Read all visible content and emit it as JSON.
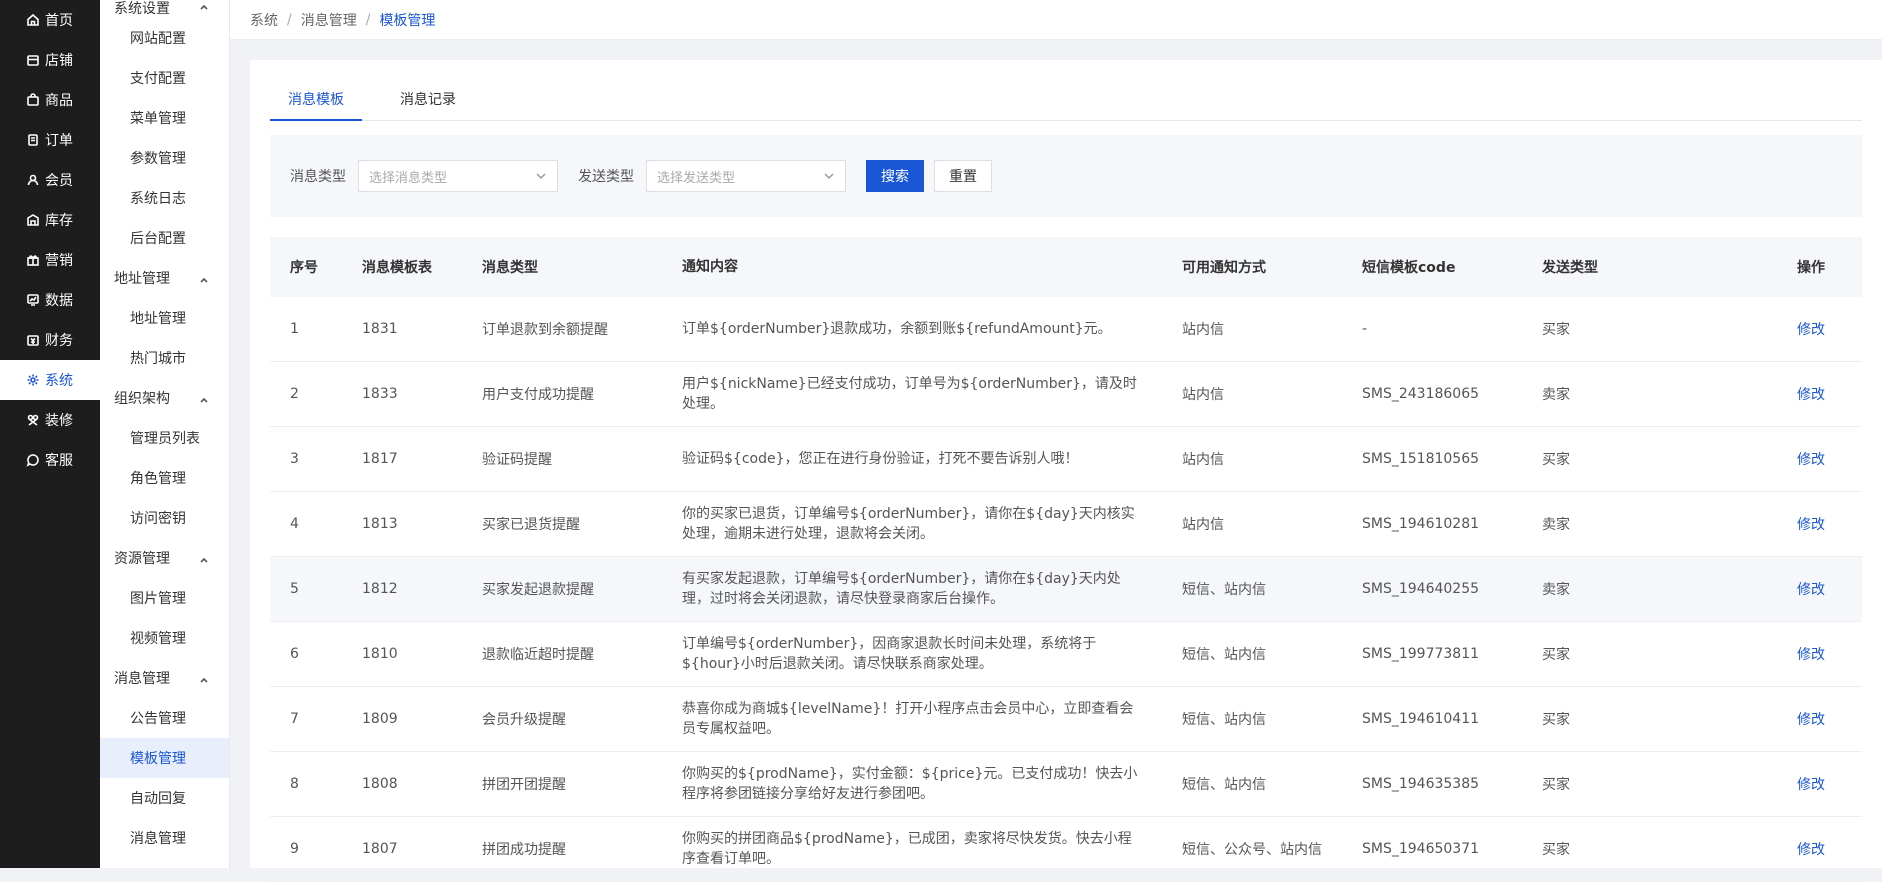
{
  "nav": [
    {
      "label": "首页",
      "icon": "home-icon"
    },
    {
      "label": "店铺",
      "icon": "shop-icon"
    },
    {
      "label": "商品",
      "icon": "product-icon"
    },
    {
      "label": "订单",
      "icon": "order-icon"
    },
    {
      "label": "会员",
      "icon": "member-icon"
    },
    {
      "label": "库存",
      "icon": "stock-icon"
    },
    {
      "label": "营销",
      "icon": "marketing-icon"
    },
    {
      "label": "数据",
      "icon": "data-icon"
    },
    {
      "label": "财务",
      "icon": "finance-icon"
    },
    {
      "label": "系统",
      "icon": "gear-icon"
    },
    {
      "label": "装修",
      "icon": "decorate-icon"
    },
    {
      "label": "客服",
      "icon": "service-icon"
    }
  ],
  "submenu": {
    "g1": "系统设置",
    "g1_items": [
      "网站配置",
      "支付配置",
      "菜单管理",
      "参数管理",
      "系统日志",
      "后台配置"
    ],
    "g2": "地址管理",
    "g2_items": [
      "地址管理",
      "热门城市"
    ],
    "g3": "组织架构",
    "g3_items": [
      "管理员列表",
      "角色管理",
      "访问密钥"
    ],
    "g4": "资源管理",
    "g4_items": [
      "图片管理",
      "视频管理"
    ],
    "g5": "消息管理",
    "g5_items": [
      "公告管理",
      "模板管理",
      "自动回复",
      "消息管理"
    ]
  },
  "breadcrumb": {
    "a": "系统",
    "b": "消息管理",
    "c": "模板管理",
    "sep": "/"
  },
  "tabs": {
    "t1": "消息模板",
    "t2": "消息记录"
  },
  "filters": {
    "msg_type_label": "消息类型",
    "msg_type_placeholder": "选择消息类型",
    "send_type_label": "发送类型",
    "send_type_placeholder": "选择发送类型",
    "search": "搜索",
    "reset": "重置"
  },
  "table": {
    "headers": {
      "c1": "序号",
      "c2": "消息模板表",
      "c3": "消息类型",
      "c4": "通知内容",
      "c5": "可用通知方式",
      "c6": "短信模板code",
      "c7": "发送类型",
      "c8": "操作"
    },
    "rows": [
      {
        "no": "1",
        "id": "1831",
        "type": "订单退款到余额提醒",
        "content": "订单${orderNumber}退款成功，余额到账${refundAmount}元。",
        "ways": "站内信",
        "code": "-",
        "send": "买家",
        "op": "修改"
      },
      {
        "no": "2",
        "id": "1833",
        "type": "用户支付成功提醒",
        "content": "用户${nickName}已经支付成功，订单号为${orderNumber}，请及时处理。",
        "ways": "站内信",
        "code": "SMS_243186065",
        "send": "卖家",
        "op": "修改"
      },
      {
        "no": "3",
        "id": "1817",
        "type": "验证码提醒",
        "content": "验证码${code}，您正在进行身份验证，打死不要告诉别人哦！",
        "ways": "站内信",
        "code": "SMS_151810565",
        "send": "买家",
        "op": "修改"
      },
      {
        "no": "4",
        "id": "1813",
        "type": "买家已退货提醒",
        "content": "你的买家已退货，订单编号${orderNumber}，请你在${day}天内核实处理，逾期未进行处理，退款将会关闭。",
        "ways": "站内信",
        "code": "SMS_194610281",
        "send": "卖家",
        "op": "修改"
      },
      {
        "no": "5",
        "id": "1812",
        "type": "买家发起退款提醒",
        "content": "有买家发起退款，订单编号${orderNumber}，请你在${day}天内处理，过时将会关闭退款，请尽快登录商家后台操作。",
        "ways": "短信、站内信",
        "code": "SMS_194640255",
        "send": "卖家",
        "op": "修改"
      },
      {
        "no": "6",
        "id": "1810",
        "type": "退款临近超时提醒",
        "content": "订单编号${orderNumber}，因商家退款长时间未处理，系统将于${hour}小时后退款关闭。请尽快联系商家处理。",
        "ways": "短信、站内信",
        "code": "SMS_199773811",
        "send": "买家",
        "op": "修改"
      },
      {
        "no": "7",
        "id": "1809",
        "type": "会员升级提醒",
        "content": "恭喜你成为商城${levelName}！打开小程序点击会员中心，立即查看会员专属权益吧。",
        "ways": "短信、站内信",
        "code": "SMS_194610411",
        "send": "买家",
        "op": "修改"
      },
      {
        "no": "8",
        "id": "1808",
        "type": "拼团开团提醒",
        "content": "你购买的${prodName}，实付金额：${price}元。已支付成功！快去小程序将参团链接分享给好友进行参团吧。",
        "ways": "短信、站内信",
        "code": "SMS_194635385",
        "send": "买家",
        "op": "修改"
      },
      {
        "no": "9",
        "id": "1807",
        "type": "拼团成功提醒",
        "content": "你购买的拼团商品${prodName}，已成团，卖家将尽快发货。快去小程序查看订单吧。",
        "ways": "短信、公众号、站内信",
        "code": "SMS_194650371",
        "send": "买家",
        "op": "修改"
      }
    ]
  },
  "colors": {
    "accent": "#1a57d6",
    "nav_bg": "#1d1d1d"
  }
}
